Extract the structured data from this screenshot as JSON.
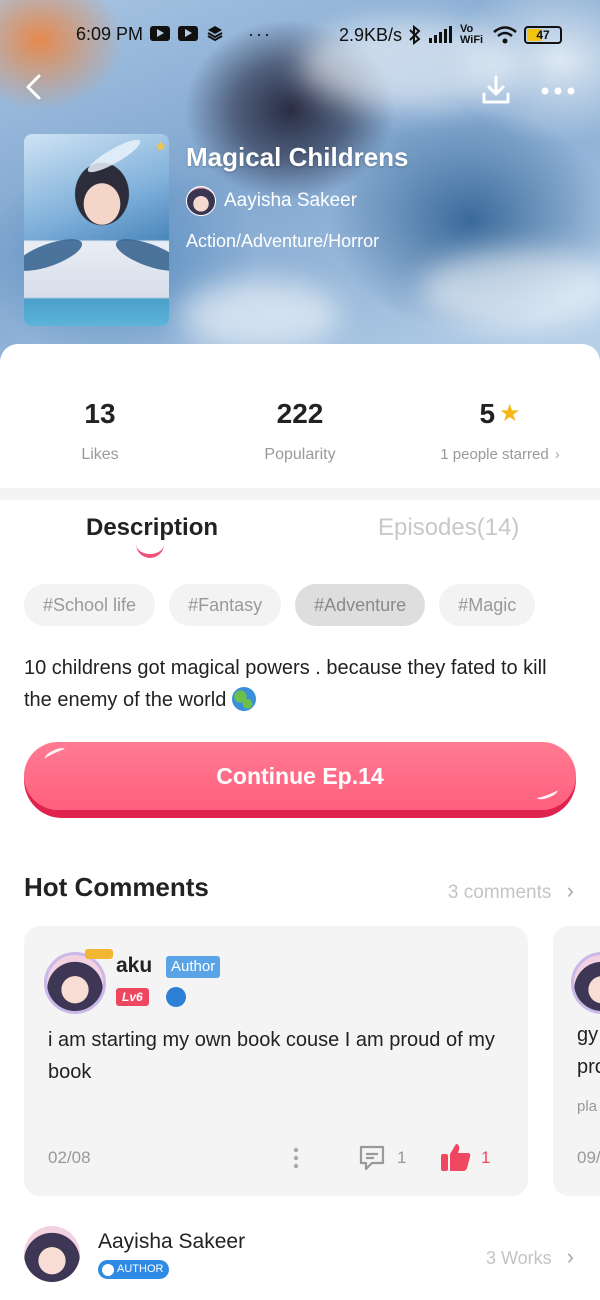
{
  "status_bar": {
    "time": "6:09 PM",
    "left_icons": [
      "youtube-icon",
      "youtube-icon",
      "stack-icon",
      "more-dots"
    ],
    "network_speed": "2.9KB/s",
    "wifi_label": "Vo WiFi",
    "battery_level": "47"
  },
  "header": {
    "title": "Magical Childrens",
    "author": "Aayisha Sakeer",
    "genres": "Action/Adventure/Horror"
  },
  "stats": {
    "likes_value": "13",
    "likes_label": "Likes",
    "popularity_value": "222",
    "popularity_label": "Popularity",
    "rating_value": "5",
    "rating_label": "1 people starred"
  },
  "tabs": {
    "description": "Description",
    "episodes": "Episodes(14)"
  },
  "tags": [
    "#School life",
    "#Fantasy",
    "#Adventure",
    "#Magic"
  ],
  "description": "10 childrens got magical powers . because they fated to kill the enemy of the world",
  "continue_button": "Continue Ep.14",
  "comments": {
    "title": "Hot Comments",
    "count_label": "3 comments",
    "items": [
      {
        "user": "aku",
        "badge": "Author",
        "level": "Lv6",
        "text": "i am starting my own book couse I am proud of my book",
        "date": "02/08",
        "replies": "1",
        "likes": "1"
      },
      {
        "text_line1": "gy",
        "text_line2": "pro",
        "text_line3": "pla",
        "date": "09/"
      }
    ]
  },
  "author_section": {
    "name": "Aayisha Sakeer",
    "badge": "AUTHOR",
    "works": "3 Works"
  },
  "colors": {
    "accent": "#ff5f7d",
    "like_red": "#ef4760",
    "author_badge_blue": "#5aa3e6"
  }
}
